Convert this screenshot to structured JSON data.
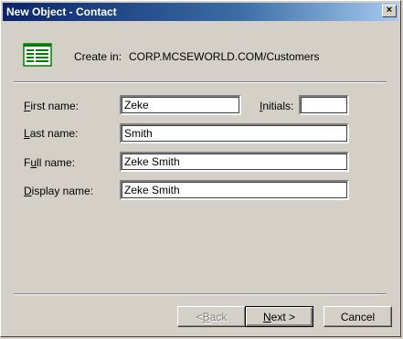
{
  "window": {
    "title": "New Object - Contact",
    "close_glyph": "×"
  },
  "header": {
    "create_in_label": "Create in:",
    "create_in_path": "CORP.MCSEWORLD.COM/Customers"
  },
  "form": {
    "first_name": {
      "label_key": "F",
      "label_rest": "irst name:",
      "value": "Zeke"
    },
    "initials": {
      "label_key": "I",
      "label_rest": "nitials:",
      "value": ""
    },
    "last_name": {
      "label_key": "L",
      "label_rest": "ast name:",
      "value": "Smith"
    },
    "full_name": {
      "label_pre": "F",
      "label_key": "u",
      "label_rest": "ll name:",
      "value": "Zeke Smith"
    },
    "display_name": {
      "label_key": "D",
      "label_rest": "isplay name:",
      "value": "Zeke Smith"
    }
  },
  "buttons": {
    "back": {
      "prefix": "< ",
      "key": "B",
      "rest": "ack"
    },
    "next": {
      "key": "N",
      "rest": "ext >"
    },
    "cancel": "Cancel"
  },
  "colors": {
    "titlebar_start": "#0a246a",
    "titlebar_end": "#a6caf0",
    "dialog_bg": "#d4d0c8",
    "icon_green": "#008000"
  }
}
